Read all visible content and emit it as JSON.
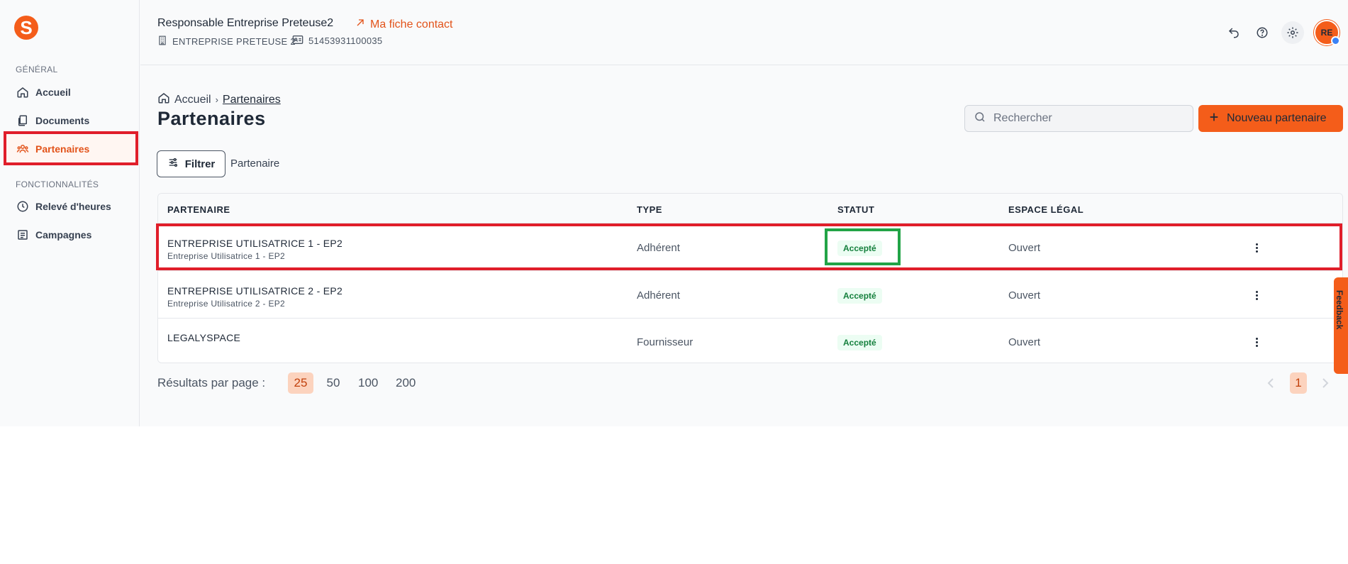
{
  "sidebar": {
    "logo_letter": "S",
    "section_general": "GÉNÉRAL",
    "section_features": "FONCTIONNALITÉS",
    "items": [
      {
        "label": "Accueil",
        "icon": "home-icon"
      },
      {
        "label": "Documents",
        "icon": "documents-icon"
      },
      {
        "label": "Partenaires",
        "icon": "partners-icon",
        "active": true
      },
      {
        "label": "Relevé d'heures",
        "icon": "clock-icon"
      },
      {
        "label": "Campagnes",
        "icon": "campaign-icon"
      }
    ]
  },
  "header": {
    "user_title": "Responsable Entreprise Preteuse2",
    "contact_link": "Ma fiche contact",
    "company": "ENTREPRISE PRETEUSE 2",
    "siret": "51453931100035",
    "avatar_initials": "RE"
  },
  "breadcrumb": {
    "home": "Accueil",
    "current": "Partenaires"
  },
  "page": {
    "title": "Partenaires"
  },
  "search": {
    "placeholder": "Rechercher"
  },
  "new_button": {
    "label": "Nouveau partenaire"
  },
  "filter": {
    "button_label": "Filtrer",
    "active_tag": "Partenaire"
  },
  "table": {
    "headers": [
      "PARTENAIRE",
      "TYPE",
      "STATUT",
      "ESPACE LÉGAL"
    ],
    "rows": [
      {
        "name": "ENTREPRISE UTILISATRICE 1 - EP2",
        "subname": "Entreprise Utilisatrice 1 - EP2",
        "type": "Adhérent",
        "status": "Accepté",
        "legal": "Ouvert"
      },
      {
        "name": "ENTREPRISE UTILISATRICE 2 - EP2",
        "subname": "Entreprise Utilisatrice 2 - EP2",
        "type": "Adhérent",
        "status": "Accepté",
        "legal": "Ouvert"
      },
      {
        "name": "LEGALYSPACE",
        "subname": "",
        "type": "Fournisseur",
        "status": "Accepté",
        "legal": "Ouvert"
      }
    ]
  },
  "pagination": {
    "label": "Résultats par page :",
    "sizes": [
      "25",
      "50",
      "100",
      "200"
    ],
    "selected_size": "25",
    "current_page": "1"
  },
  "feedback": {
    "label": "Feedback"
  },
  "colors": {
    "accent": "#f45d1a",
    "highlight_red": "#e01e2a",
    "highlight_green": "#22a447",
    "status_green": "#15803d"
  }
}
